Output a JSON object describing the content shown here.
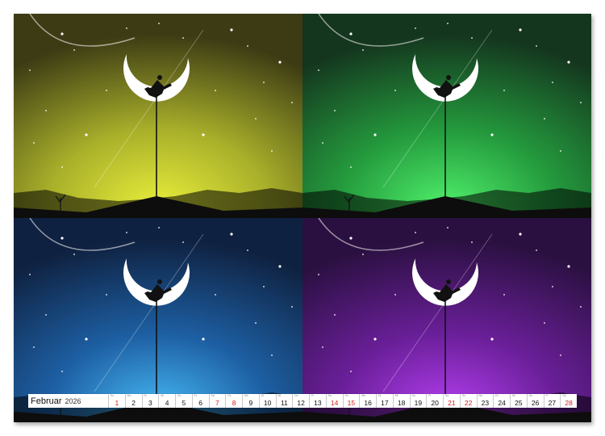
{
  "calendar": {
    "month": "Februar",
    "year": "2026",
    "days": [
      {
        "wd": "So",
        "num": "1",
        "weekend": true
      },
      {
        "wd": "Mo",
        "num": "2",
        "weekend": false
      },
      {
        "wd": "Di",
        "num": "3",
        "weekend": false
      },
      {
        "wd": "Mi",
        "num": "4",
        "weekend": false
      },
      {
        "wd": "Do",
        "num": "5",
        "weekend": false
      },
      {
        "wd": "Fr",
        "num": "6",
        "weekend": false
      },
      {
        "wd": "Sa",
        "num": "7",
        "weekend": true
      },
      {
        "wd": "So",
        "num": "8",
        "weekend": true
      },
      {
        "wd": "Mo",
        "num": "9",
        "weekend": false
      },
      {
        "wd": "Di",
        "num": "10",
        "weekend": false
      },
      {
        "wd": "Mi",
        "num": "11",
        "weekend": false
      },
      {
        "wd": "Do",
        "num": "12",
        "weekend": false
      },
      {
        "wd": "Fr",
        "num": "13",
        "weekend": false
      },
      {
        "wd": "Sa",
        "num": "14",
        "weekend": true
      },
      {
        "wd": "So",
        "num": "15",
        "weekend": true
      },
      {
        "wd": "Mo",
        "num": "16",
        "weekend": false
      },
      {
        "wd": "Di",
        "num": "17",
        "weekend": false
      },
      {
        "wd": "Mi",
        "num": "18",
        "weekend": false
      },
      {
        "wd": "Do",
        "num": "19",
        "weekend": false
      },
      {
        "wd": "Fr",
        "num": "20",
        "weekend": false
      },
      {
        "wd": "Sa",
        "num": "21",
        "weekend": true
      },
      {
        "wd": "So",
        "num": "22",
        "weekend": true
      },
      {
        "wd": "Mo",
        "num": "23",
        "weekend": false
      },
      {
        "wd": "Di",
        "num": "24",
        "weekend": false
      },
      {
        "wd": "Mi",
        "num": "25",
        "weekend": false
      },
      {
        "wd": "Do",
        "num": "26",
        "weekend": false
      },
      {
        "wd": "Fr",
        "num": "27",
        "weekend": false
      },
      {
        "wd": "Sa",
        "num": "28",
        "weekend": true
      }
    ]
  },
  "panels": [
    {
      "name": "yellow",
      "glow": "#e8ee3a",
      "mid": "#a9b02a",
      "top": "#3c3b14"
    },
    {
      "name": "green",
      "glow": "#4ff06a",
      "mid": "#249a3d",
      "top": "#14351e"
    },
    {
      "name": "blue",
      "glow": "#46b8f4",
      "mid": "#1d5fa3",
      "top": "#0f2140"
    },
    {
      "name": "purple",
      "glow": "#b43ef0",
      "mid": "#6a1f99",
      "top": "#2a1040"
    }
  ],
  "colors": {
    "weekend": "#d21f1f"
  }
}
